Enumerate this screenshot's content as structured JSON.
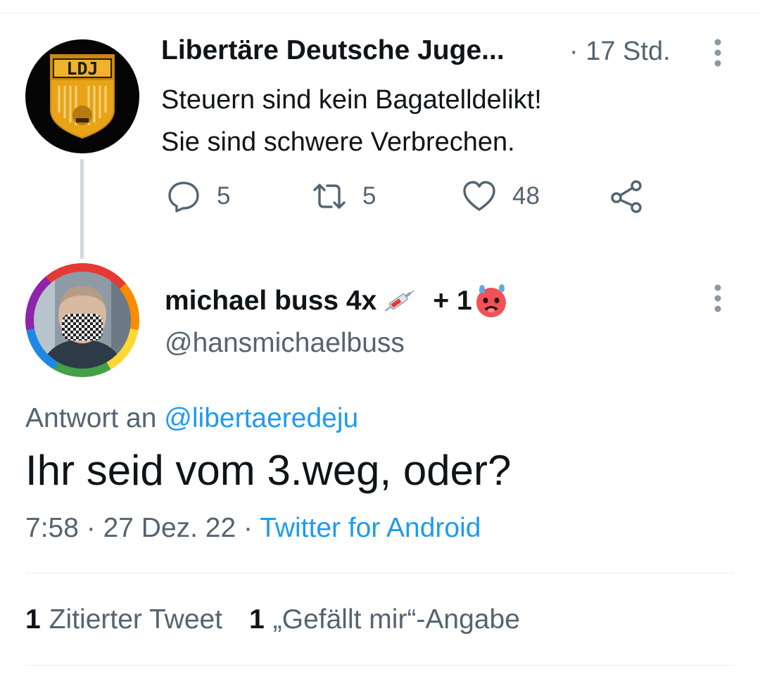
{
  "parent_tweet": {
    "avatar_text": "LDJ",
    "name": "Libertäre Deutsche Juge...",
    "time": "· 17 Std.",
    "text_lines": [
      "Steuern sind kein Bagatelldelikt!",
      "Sie sind schwere Verbrechen."
    ],
    "actions": {
      "reply_count": "5",
      "retweet_count": "5",
      "like_count": "48"
    }
  },
  "reply_tweet": {
    "name": "michael buss 4x",
    "name_suffix": "+ 1",
    "handle": "@hansmichaelbuss",
    "reply_to_label": "Antwort an",
    "reply_to_mention": "@libertaeredeju",
    "text": "Ihr seid vom 3.weg, oder?",
    "timestamp": "7:58 · 27 Dez. 22 ·",
    "source": "Twitter for Android",
    "stats": [
      {
        "count": "1",
        "label": "Zitierter Tweet"
      },
      {
        "count": "1",
        "label": "„Gefällt mir“-Angabe"
      }
    ]
  },
  "icons": {
    "reply": "reply-icon",
    "retweet": "retweet-icon",
    "like": "heart-icon",
    "share": "share-icon",
    "more": "more-vertical-icon",
    "syringe": "syringe-emoji",
    "face": "hot-face-emoji"
  },
  "colors": {
    "text": "#0f1419",
    "secondary": "#536471",
    "link": "#1d9bf0",
    "divider": "#e6ecf0",
    "ldj_gold": "#e8a317"
  }
}
